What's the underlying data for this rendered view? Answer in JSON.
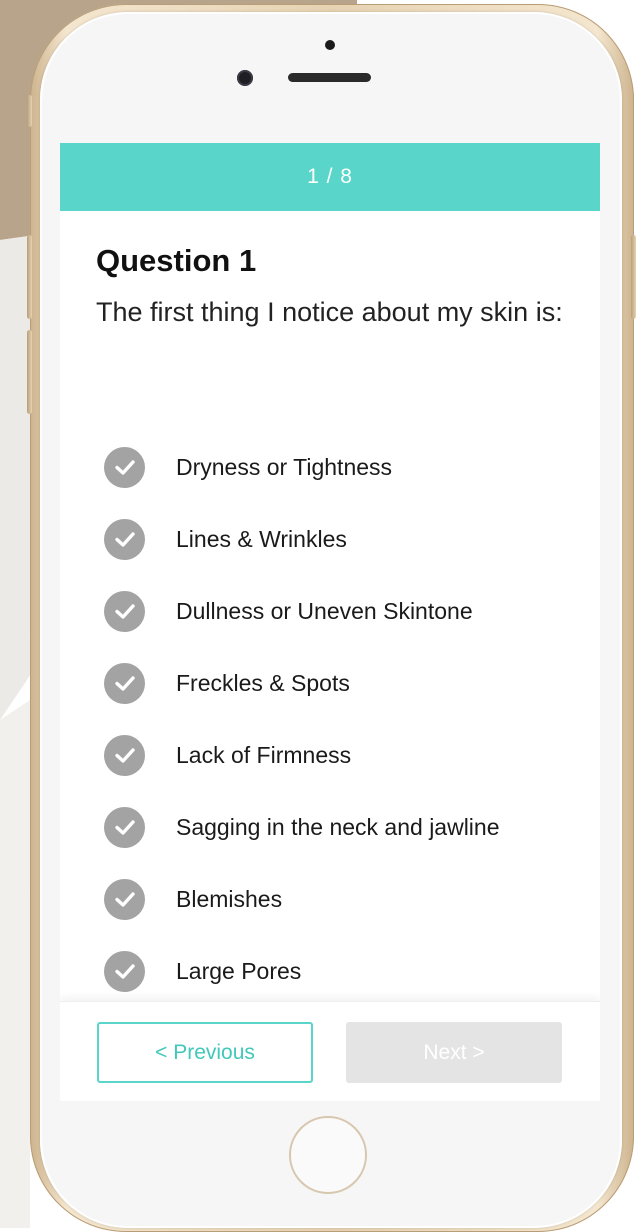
{
  "quiz": {
    "progress": "1 / 8",
    "question_title": "Question 1",
    "question_text": "The first thing I notice about my skin is:",
    "options": [
      "Dryness or Tightness",
      "Lines & Wrinkles",
      "Dullness or Uneven Skintone",
      "Freckles & Spots",
      "Lack of Firmness",
      "Sagging in the neck and jawline",
      "Blemishes",
      "Large Pores"
    ],
    "previous_label": "< Previous",
    "next_label": "Next >"
  },
  "colors": {
    "accent": "#59d6c9",
    "check_inactive": "#a3a3a3",
    "next_disabled": "#e4e4e4",
    "background_tan": "#b8a48a"
  },
  "icons": {
    "option_check": "check-circle-icon",
    "camera": "front-camera-icon",
    "home": "home-button"
  }
}
